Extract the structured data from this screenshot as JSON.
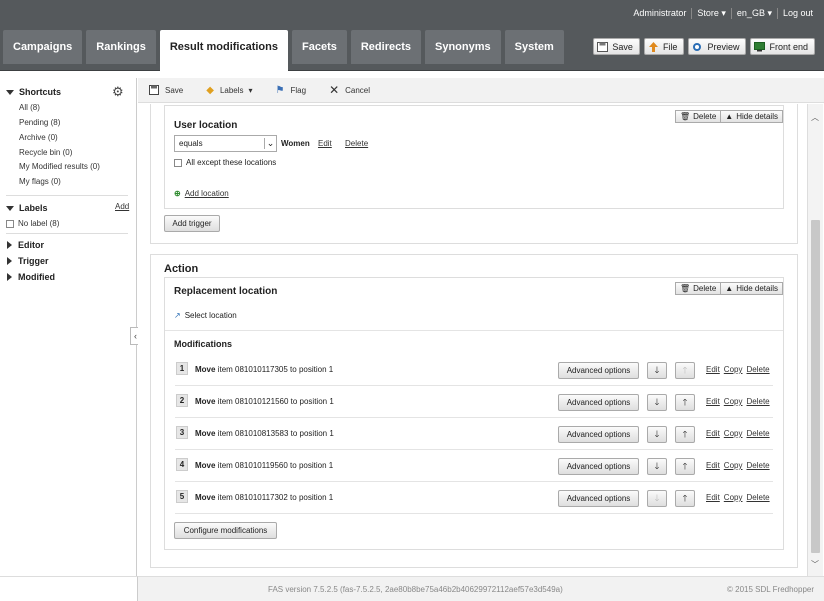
{
  "header": {
    "util": [
      "Administrator",
      "Store ▾",
      "en_GB ▾",
      "Log out"
    ],
    "tabs": [
      "Campaigns",
      "Rankings",
      "Result modifications",
      "Facets",
      "Redirects",
      "Synonyms",
      "System"
    ],
    "active_tab": "Result modifications",
    "actions": [
      {
        "label": "Save",
        "icon": "save-icon",
        "color": "#555"
      },
      {
        "label": "File",
        "icon": "upload-icon",
        "color": "#e08a1e"
      },
      {
        "label": "Preview",
        "icon": "preview-icon",
        "color": "#2a6db5"
      },
      {
        "label": "Front end",
        "icon": "monitor-icon",
        "color": "#2e7d32"
      }
    ]
  },
  "sidebar": {
    "shortcuts_title": "Shortcuts",
    "shortcuts": [
      "All (8)",
      "Pending (8)",
      "Archive (0)",
      "Recycle bin (0)",
      "My Modified results (0)",
      "My flags (0)"
    ],
    "labels_title": "Labels",
    "labels_add": "Add",
    "labels_items": [
      "No label (8)"
    ],
    "sections": [
      "Editor",
      "Trigger",
      "Modified"
    ]
  },
  "toolbar": {
    "save": "Save",
    "labels": "Labels",
    "flag": "Flag",
    "cancel": "Cancel"
  },
  "trigger": {
    "user_location_title": "User location",
    "delete": "Delete",
    "hide_details": "Hide details",
    "operator": "equals",
    "value": "Women",
    "edit": "Edit",
    "delete_link": "Delete",
    "all_except": "All except these locations",
    "add_location": "Add location",
    "add_trigger": "Add trigger"
  },
  "action": {
    "title": "Action",
    "replacement_title": "Replacement location",
    "delete": "Delete",
    "hide_details": "Hide details",
    "select_location": "Select location",
    "modifications_title": "Modifications",
    "advanced_options": "Advanced options",
    "links": [
      "Edit",
      "Copy",
      "Delete"
    ],
    "move_word": "Move",
    "modifications": [
      {
        "num": "1",
        "text": "item 081010117305 to position 1",
        "down_enabled": true,
        "up_enabled": false
      },
      {
        "num": "2",
        "text": "item 081010121560 to position 1",
        "down_enabled": true,
        "up_enabled": true
      },
      {
        "num": "3",
        "text": "item 081010813583 to position 1",
        "down_enabled": true,
        "up_enabled": true
      },
      {
        "num": "4",
        "text": "item 081010119560 to position 1",
        "down_enabled": true,
        "up_enabled": true
      },
      {
        "num": "5",
        "text": "item 081010117302 to position 1",
        "down_enabled": false,
        "up_enabled": true
      }
    ],
    "configure": "Configure modifications"
  },
  "footer": {
    "version": "FAS version 7.5.2.5 (fas-7.5.2.5, 2ae80b8be75a46b2b40629972112aef57e3d549a)",
    "copyright": "© 2015 SDL Fredhopper"
  }
}
